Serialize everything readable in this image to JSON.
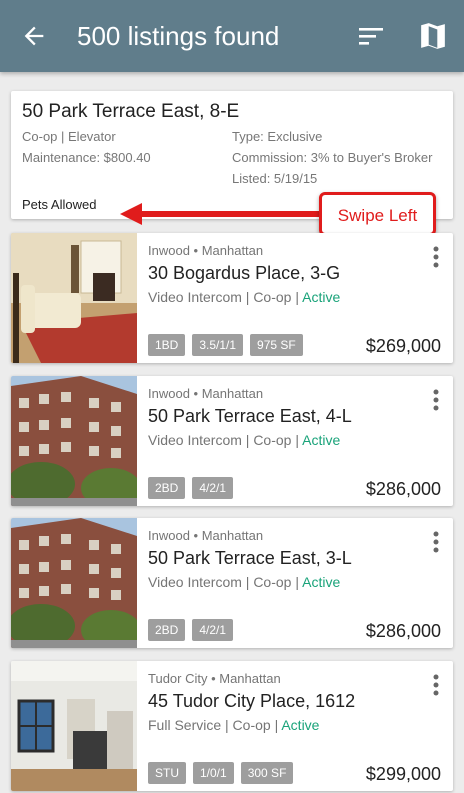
{
  "appbar": {
    "title": "500 listings found",
    "back_icon": "arrow-left-icon",
    "sort_icon": "sort-icon",
    "map_icon": "map-icon"
  },
  "swipe_card": {
    "address": "50 Park Terrace East, 8-E",
    "type_line": "Co-op | Elevator",
    "maintenance": "Maintenance: $800.40",
    "listing_type": "Type: Exclusive",
    "commission": "Commission: 3% to Buyer's Broker",
    "listed": "Listed: 5/19/15",
    "pets": "Pets Allowed"
  },
  "callout": {
    "label": "Swipe Left",
    "color": "#e01c1c"
  },
  "listings": [
    {
      "neighborhood": "Inwood • Manhattan",
      "address": "30 Bogardus Place, 3-G",
      "amenities": "Video Intercom | Co-op |",
      "status": "Active",
      "tags": [
        "1BD",
        "3.5/1/1",
        "975 SF"
      ],
      "price": "$269,000"
    },
    {
      "neighborhood": "Inwood • Manhattan",
      "address": "50 Park Terrace East, 4-L",
      "amenities": "Video Intercom | Co-op |",
      "status": "Active",
      "tags": [
        "2BD",
        "4/2/1"
      ],
      "price": "$286,000"
    },
    {
      "neighborhood": "Inwood • Manhattan",
      "address": "50 Park Terrace East, 3-L",
      "amenities": "Video Intercom | Co-op |",
      "status": "Active",
      "tags": [
        "2BD",
        "4/2/1"
      ],
      "price": "$286,000"
    },
    {
      "neighborhood": "Tudor City • Manhattan",
      "address": "45 Tudor City Place, 1612",
      "amenities": "Full Service | Co-op |",
      "status": "Active",
      "tags": [
        "STU",
        "1/0/1",
        "300 SF"
      ],
      "price": "$299,000"
    }
  ],
  "colors": {
    "appbar": "#607d8b",
    "active": "#1aa37a",
    "tag": "#9e9e9e"
  }
}
